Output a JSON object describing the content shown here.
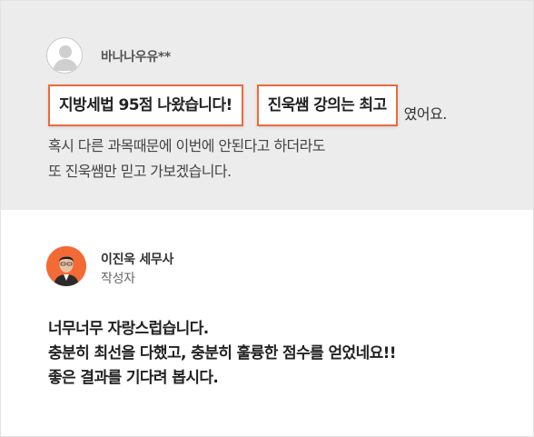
{
  "review": {
    "username": "바나나우유**",
    "avatar_icon": "user-silhouette-icon",
    "highlights": [
      "지방세법 95점 나왔습니다!",
      "진욱쌤 강의는 최고"
    ],
    "highlight_border_color": "#ec6a3e",
    "suffix": "였어요.",
    "lines": [
      "혹시 다른 과목때문에 이번에 안된다고 하더라도",
      "또 진욱쌤만 믿고 가보겠습니다."
    ],
    "background_color": "#ececec"
  },
  "reply": {
    "author_name": "이진욱 세무사",
    "author_role": "작성자",
    "avatar_icon": "author-photo-icon",
    "avatar_color": "#f26a36",
    "lines": [
      "너무너무 자랑스럽습니다.",
      "충분히 최선을 다했고, 충분히 훌륭한 점수를 얻었네요!!",
      "좋은 결과를 기다려 봅시다."
    ]
  }
}
